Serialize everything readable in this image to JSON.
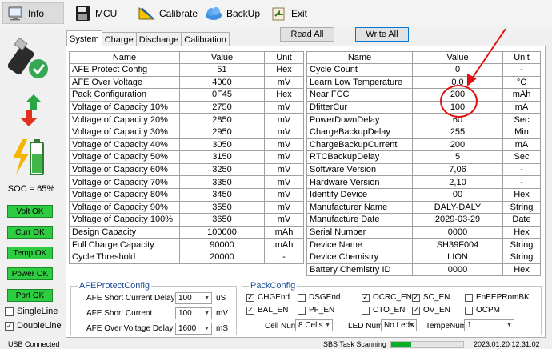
{
  "toolbar": {
    "items": [
      {
        "label": "Info",
        "icon": "info-icon"
      },
      {
        "label": "MCU",
        "icon": "floppy-disk-icon"
      },
      {
        "label": "Calibrate",
        "icon": "calibrate-icon"
      },
      {
        "label": "BackUp",
        "icon": "cloud-icon"
      },
      {
        "label": "Exit",
        "icon": "exit-icon"
      }
    ]
  },
  "sidebar": {
    "soc": "SOC = 65%",
    "indicators": [
      "Volt OK",
      "Curr OK",
      "Temp OK",
      "Power OK",
      "Port OK"
    ],
    "options": [
      {
        "label": "SingleLine",
        "checked": false
      },
      {
        "label": "DoubleLine",
        "checked": true
      }
    ]
  },
  "tabs": [
    "System",
    "Charge",
    "Discharge",
    "Calibration"
  ],
  "buttons": {
    "read_all": "Read All",
    "write_all": "Write All"
  },
  "left_table": {
    "headers": [
      "Name",
      "Value",
      "Unit"
    ],
    "rows": [
      [
        "AFE Protect Config",
        "51",
        "Hex"
      ],
      [
        "AFE Over Voltage",
        "4000",
        "mV"
      ],
      [
        "Pack Configuration",
        "0F45",
        "Hex"
      ],
      [
        "Voltage of Capacity 10%",
        "2750",
        "mV"
      ],
      [
        "Voltage of Capacity 20%",
        "2850",
        "mV"
      ],
      [
        "Voltage of Capacity 30%",
        "2950",
        "mV"
      ],
      [
        "Voltage of Capacity 40%",
        "3050",
        "mV"
      ],
      [
        "Voltage of Capacity 50%",
        "3150",
        "mV"
      ],
      [
        "Voltage of Capacity 60%",
        "3250",
        "mV"
      ],
      [
        "Voltage of Capacity 70%",
        "3350",
        "mV"
      ],
      [
        "Voltage of Capacity 80%",
        "3450",
        "mV"
      ],
      [
        "Voltage of Capacity 90%",
        "3550",
        "mV"
      ],
      [
        "Voltage of Capacity 100%",
        "3650",
        "mV"
      ],
      [
        "Design Capacity",
        "100000",
        "mAh"
      ],
      [
        "Full Charge Capacity",
        "90000",
        "mAh"
      ],
      [
        "Cycle Threshold",
        "20000",
        "-"
      ]
    ]
  },
  "right_table": {
    "headers": [
      "Name",
      "Value",
      "Unit"
    ],
    "rows": [
      [
        "Cycle Count",
        "0",
        "-"
      ],
      [
        "Learn Low Temperature",
        "0.0",
        "°C"
      ],
      [
        "Near FCC",
        "200",
        "mAh"
      ],
      [
        "DfitterCur",
        "100",
        "mA"
      ],
      [
        "PowerDownDelay",
        "60",
        "Sec"
      ],
      [
        "ChargeBackupDelay",
        "255",
        "Min"
      ],
      [
        "ChargeBackupCurrent",
        "200",
        "mA"
      ],
      [
        "RTCBackupDelay",
        "5",
        "Sec"
      ],
      [
        "Software Version",
        "7,06",
        "-"
      ],
      [
        "Hardware Version",
        "2,10",
        "-"
      ],
      [
        "Identify Device",
        "00",
        "Hex"
      ],
      [
        "Manufacturer Name",
        "DALY-DALY",
        "String"
      ],
      [
        "Manufacture Date",
        "2029-03-29",
        "Date"
      ],
      [
        "Serial Number",
        "0000",
        "Hex"
      ],
      [
        "Device Name",
        "SH39F004",
        "String"
      ],
      [
        "Device Chemistry",
        "LION",
        "String"
      ],
      [
        "Battery Chemistry ID",
        "0000",
        "Hex"
      ]
    ]
  },
  "afe": {
    "title": "AFEProtectConfig",
    "rows": [
      {
        "label": "AFE Short Current Delay",
        "value": "100",
        "unit": "uS"
      },
      {
        "label": "AFE Short Current",
        "value": "100",
        "unit": "mV"
      },
      {
        "label": "AFE Over Voltage Delay",
        "value": "1600",
        "unit": "mS"
      }
    ]
  },
  "pack": {
    "title": "PackConfig",
    "flags": [
      {
        "label": "CHGEnd",
        "checked": true
      },
      {
        "label": "DSGEnd",
        "checked": false
      },
      {
        "label": "OCRC_EN",
        "checked": true
      },
      {
        "label": "SC_EN",
        "checked": true
      },
      {
        "label": "EnEEPRomBK",
        "checked": false
      },
      {
        "label": "BAL_EN",
        "checked": true
      },
      {
        "label": "PF_EN",
        "checked": false
      },
      {
        "label": "CTO_EN",
        "checked": false
      },
      {
        "label": "OV_EN",
        "checked": true
      },
      {
        "label": "OCPM",
        "checked": false
      }
    ],
    "cell_num_label": "Cell Num",
    "cell_num_value": "8 Cells",
    "led_num_label": "LED Num",
    "led_num_value": "No Leds",
    "tempe_num_label": "TempeNum",
    "tempe_num_value": "1"
  },
  "status": {
    "connection": "USB Connected",
    "task": "SBS Task Scanning",
    "progress_fraction": 0.28,
    "datetime": "2023.01.20  12:31:02"
  },
  "colors": {
    "indicator_green": "#2ecc40",
    "highlight_red": "#e01010",
    "progress_green": "#06b025"
  }
}
